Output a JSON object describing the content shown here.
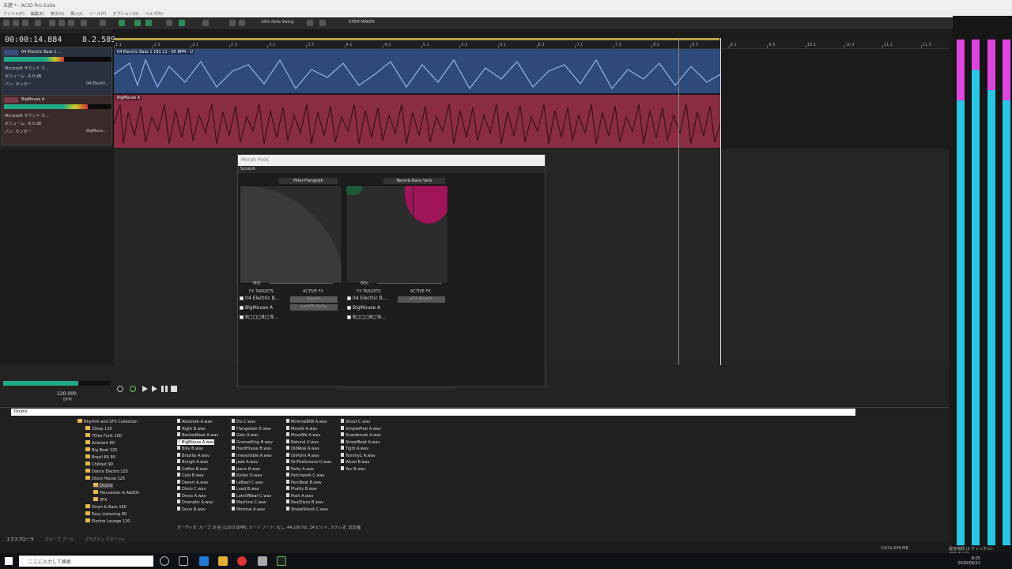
{
  "window": {
    "title": "未題 * - ACID Pro Suite"
  },
  "menu": [
    "ファイル(F)",
    "編集(E)",
    "表示(V)",
    "挿入(I)",
    "ツール(T)",
    "オプション(O)",
    "ヘルプ(H)"
  ],
  "toolbar": {
    "swing": "16th Note Swing",
    "stem": "STEM MAKER"
  },
  "transport": {
    "time": "00:00:14.884",
    "measure": "8.2.589",
    "bpm": "120.000",
    "bpm_label": "BPM"
  },
  "tracks": [
    {
      "name": "04 Electric Bass 1 ...",
      "device": "Microsoft サウンド マ...",
      "vol": "ボリューム: -6.0 dB",
      "pan": "パン: センター",
      "fx": "04 Electri..."
    },
    {
      "name": "BigMouse A",
      "device": "Microsoft サウンド マ...",
      "vol": "ボリューム: -6.0 dB",
      "pan": "パン: センター",
      "fx": "BigMous..."
    }
  ],
  "clips": {
    "bass": "04 Electric Bass 1 181 11 - 85 BPM - U",
    "drum": "BigMouse A"
  },
  "ruler": [
    "1.1",
    "1.3",
    "2.1",
    "2.3",
    "3.1",
    "3.3",
    "4.1",
    "4.3",
    "5.1",
    "5.3",
    "6.1",
    "6.3",
    "7.1",
    "7.3",
    "8.1",
    "8.3",
    "9.1",
    "9.3",
    "10.1",
    "10.3",
    "11.1",
    "11.3"
  ],
  "morph": {
    "title": "Morph Pods",
    "preset": "Scratch",
    "pod1": {
      "fx": "Filter-FlangerJK",
      "mix": "MIX:",
      "targets_label": "FX TARGETS",
      "active_label": "ACTIVE FX",
      "targets": [
        "04 Electric B...",
        "BigMouse A",
        "8□□□8□'8..."
      ],
      "active": [
        "Reverb",
        "coreFX Delay"
      ]
    },
    "pod2": {
      "fx": "Reverb-Rave Verb",
      "mix": "MIX:",
      "targets_label": "FX TARGETS",
      "active_label": "ACTIVE FX",
      "targets": [
        "04 Electric B...",
        "BigMouse A",
        "8□□□8□'8..."
      ],
      "active": [
        "eFX Reverb"
      ]
    }
  },
  "explorer": {
    "path": "Drums",
    "tree": [
      "Rhythm and SFX Collection",
      "2Step 135",
      "70ies Funk 100",
      "Ambient 80",
      "Big Beat 125",
      "Brazil 66 90",
      "Chillout 90",
      "Dance Electro 125",
      "Disco House 125",
      "Drums",
      "Percussion & AddOn",
      "SFX",
      "Drum & Bass 160",
      "Easy Listening 90",
      "Electro Lounge 120"
    ],
    "files": [
      [
        "Absolute A.wav",
        "Aight B.wav",
        "BackedBeat A.wav",
        "BigMouse A.wav",
        "Billy B.wav",
        "Brazilia A.wav",
        "BringIt A.wav",
        "Coffee B.wav",
        "Cold B.wav",
        "Desert A.wav",
        "Disco C.wav",
        "Dress A.wav",
        "Dramatic A.wav",
        "Dune B.wav"
      ],
      [
        "Elo C.wav",
        "Flangelizer E.wav",
        "Gain A.wav",
        "GrooveKing H.wav",
        "HardHouse B.wav",
        "Irreversible A.wav",
        "Jade A.wav",
        "Jeans B.wav",
        "Kicker D.wav",
        "LeBeat C.wav",
        "Load B.wav",
        "LotsOfBeat C.wav",
        "Machine C.wav",
        "Minimal A.wav"
      ],
      [
        "Minimal808 A.wav",
        "MoveIt A.wav",
        "MoveMe A.wav",
        "Natural U.wav",
        "OldReal A.wav",
        "OnPoint A.wav",
        "OnTheGroove D.wav",
        "Party A.wav",
        "Patchwork C.wav",
        "PercBeat B.wav",
        "Phatty B.wav",
        "Posh A.wav",
        "RealDisco B.wav",
        "ShakeShock C.wav"
      ],
      [
        "Shout C.wav",
        "SimplePhat A.wav",
        "Snarebrush A.wav",
        "StreetBeat A.wav",
        "Tight A.wav",
        "Tommy1 A.wav",
        "Wood B.wav",
        "You B.wav"
      ]
    ],
    "status": "オーディオ: ループ, 8 拍 (120.0 BPM), ルート ノート: なし, 44,100 Hz, 24 ビット, ステレオ, 非圧縮",
    "tabs": [
      "エクスプローラ",
      "グループ プール",
      "プラグイン マネージャ"
    ]
  },
  "statusbar": {
    "disk": "14/32,639 MB",
    "info": "録音時間 (2 チャンネル): 464:32:10"
  },
  "taskbar": {
    "search": "ここに入力して検索",
    "time": "8:05",
    "date": "2020/04/21"
  }
}
